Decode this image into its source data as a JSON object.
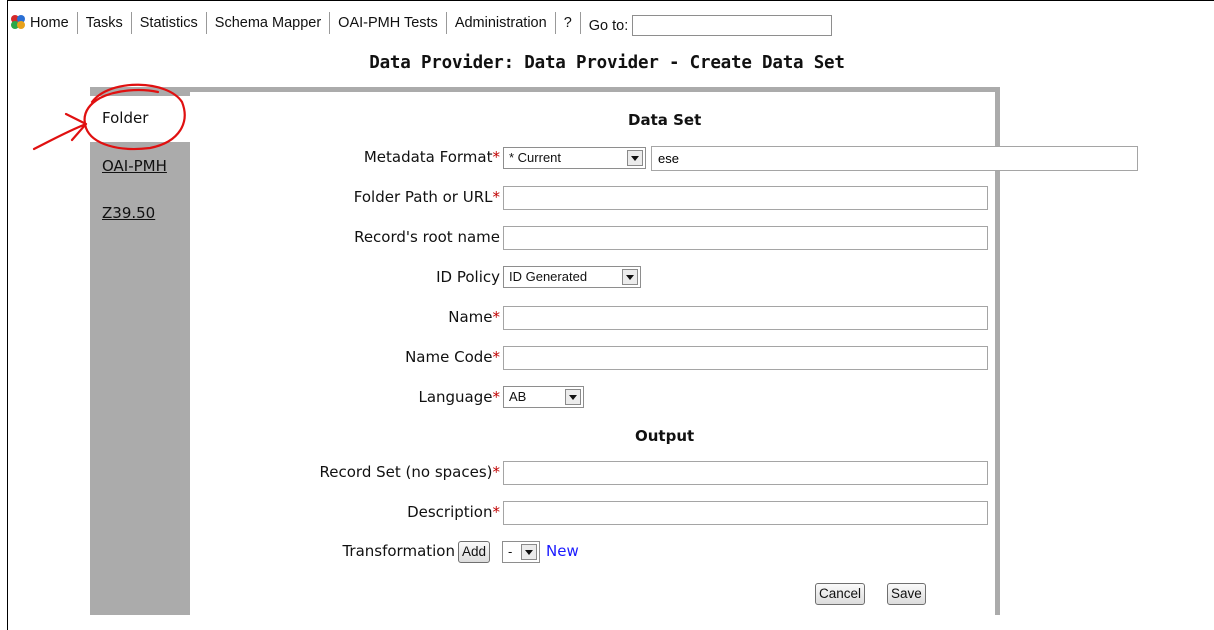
{
  "nav": {
    "items": [
      "Home",
      "Tasks",
      "Statistics",
      "Schema Mapper",
      "OAI-PMH Tests",
      "Administration",
      "?"
    ],
    "goto_label": "Go to:",
    "goto_value": ""
  },
  "page_title": "Data Provider: Data Provider - Create Data Set",
  "sidebar": {
    "items": [
      {
        "label": "Folder",
        "active": true
      },
      {
        "label": "OAI-PMH",
        "active": false
      },
      {
        "label": "Z39.50",
        "active": false
      }
    ]
  },
  "form": {
    "section_dataset": "Data Set",
    "section_output": "Output",
    "required_mark": "*",
    "fields": {
      "metadata_format": {
        "label": "Metadata Format",
        "select_value": "* Current",
        "text_value": "ese"
      },
      "folder_path": {
        "label": "Folder Path or URL",
        "value": ""
      },
      "root_name": {
        "label": "Record's root name",
        "value": ""
      },
      "id_policy": {
        "label": "ID Policy",
        "select_value": "ID Generated"
      },
      "name": {
        "label": "Name",
        "value": ""
      },
      "name_code": {
        "label": "Name Code",
        "value": ""
      },
      "language": {
        "label": "Language",
        "select_value": "AB"
      },
      "record_set": {
        "label": "Record Set (no spaces)",
        "value": ""
      },
      "description": {
        "label": "Description",
        "value": ""
      },
      "transformation": {
        "label": "Transformation",
        "add_label": "Add",
        "select_value": "-",
        "new_label": "New"
      }
    },
    "cancel_label": "Cancel",
    "save_label": "Save"
  },
  "colors": {
    "panel_gray": "#ababab",
    "required_red": "#c00000",
    "link_blue": "#1a1aff",
    "annotation_red": "#e01010"
  },
  "icons": [
    "app-logo-icon",
    "dropdown-arrow-icon"
  ]
}
